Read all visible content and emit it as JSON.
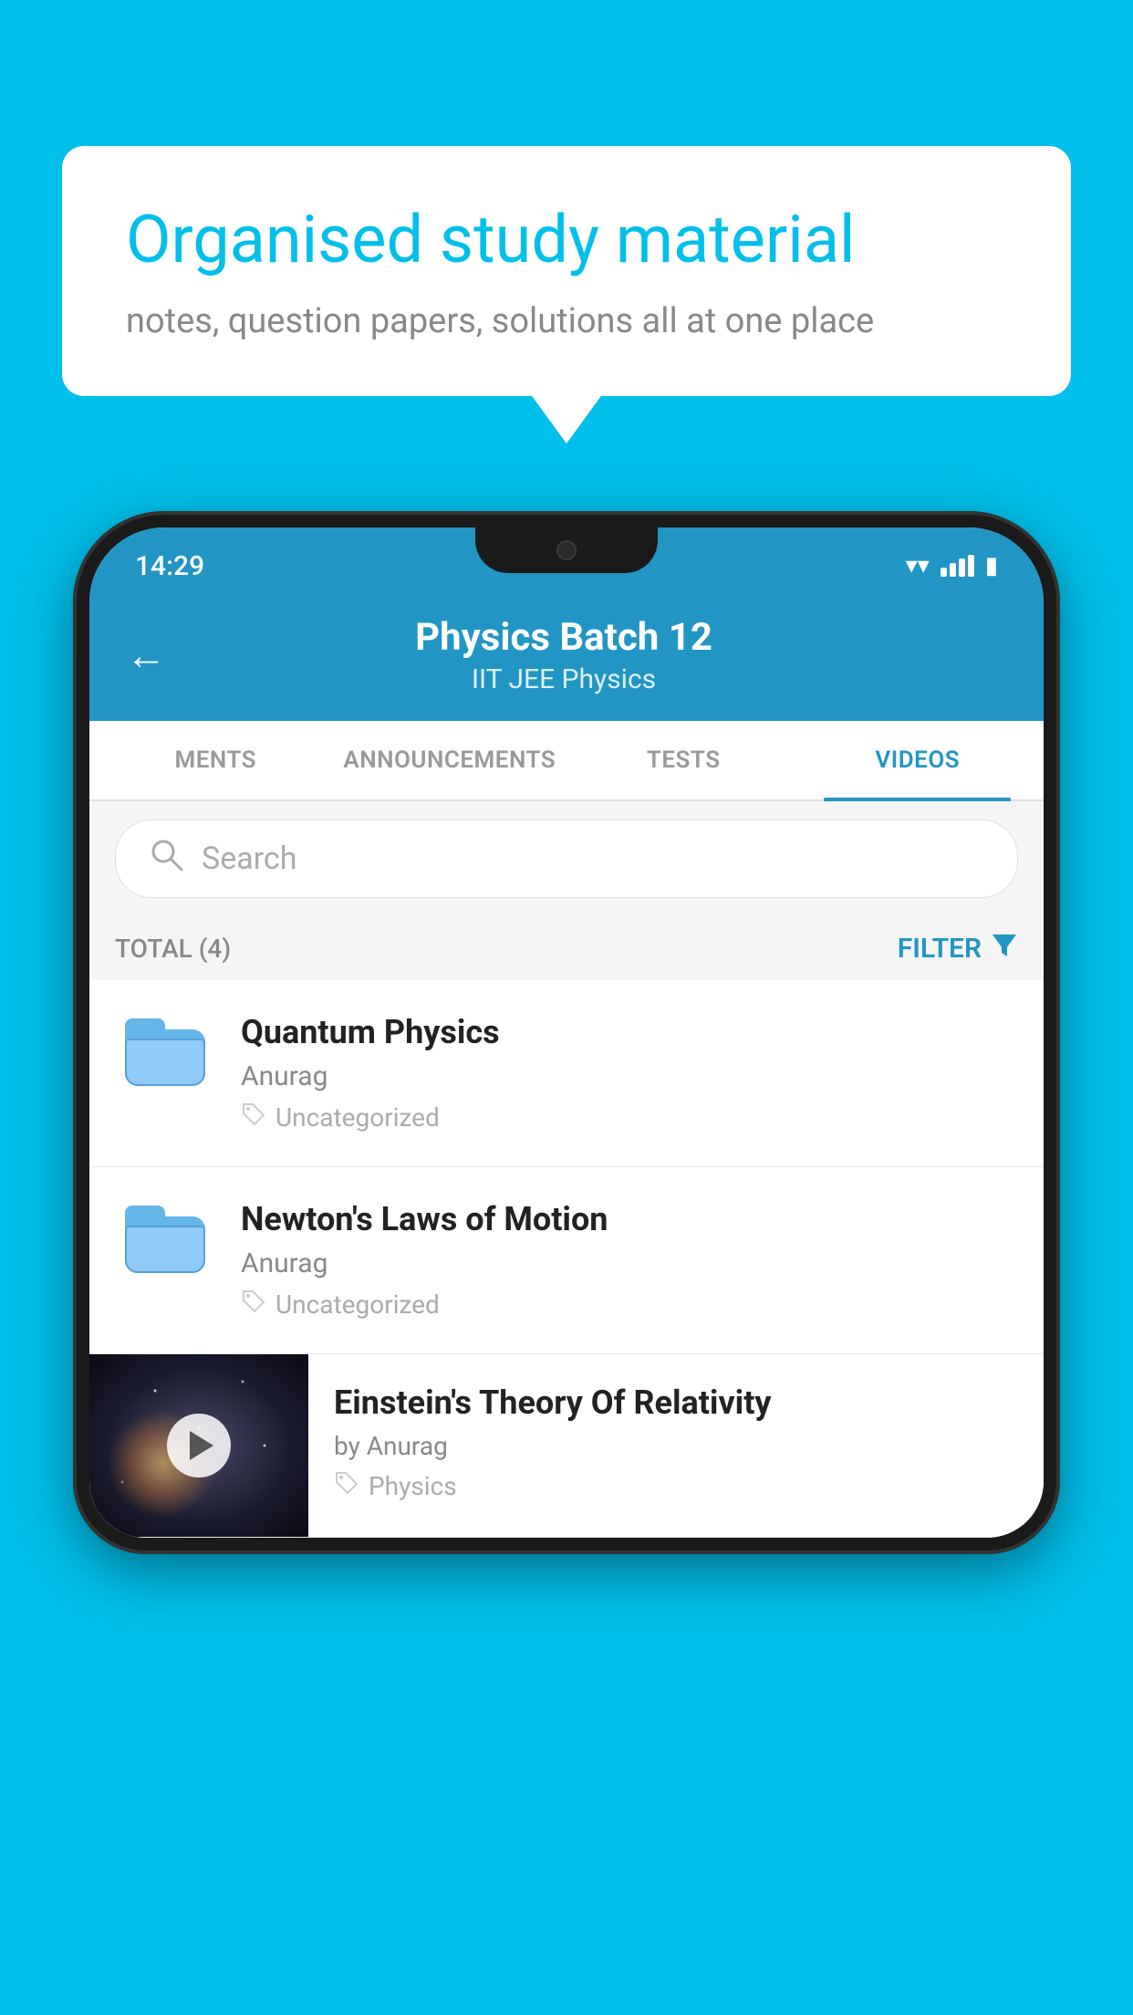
{
  "background_color": "#00BFEA",
  "speech_bubble": {
    "title": "Organised study material",
    "subtitle": "notes, question papers, solutions all at one place"
  },
  "phone": {
    "status_bar": {
      "time": "14:29"
    },
    "header": {
      "back_label": "←",
      "title": "Physics Batch 12",
      "subtitle": "IIT JEE   Physics"
    },
    "tabs": [
      {
        "label": "MENTS",
        "active": false
      },
      {
        "label": "ANNOUNCEMENTS",
        "active": false
      },
      {
        "label": "TESTS",
        "active": false
      },
      {
        "label": "VIDEOS",
        "active": true
      }
    ],
    "search": {
      "placeholder": "Search"
    },
    "filter_bar": {
      "total_label": "TOTAL (4)",
      "filter_label": "FILTER"
    },
    "video_list": [
      {
        "id": "quantum-physics",
        "type": "folder",
        "title": "Quantum Physics",
        "author": "Anurag",
        "tag": "Uncategorized"
      },
      {
        "id": "newtons-laws",
        "type": "folder",
        "title": "Newton's Laws of Motion",
        "author": "Anurag",
        "tag": "Uncategorized"
      },
      {
        "id": "einsteins-theory",
        "type": "thumbnail",
        "title": "Einstein's Theory Of Relativity",
        "author": "by Anurag",
        "tag": "Physics"
      }
    ]
  }
}
